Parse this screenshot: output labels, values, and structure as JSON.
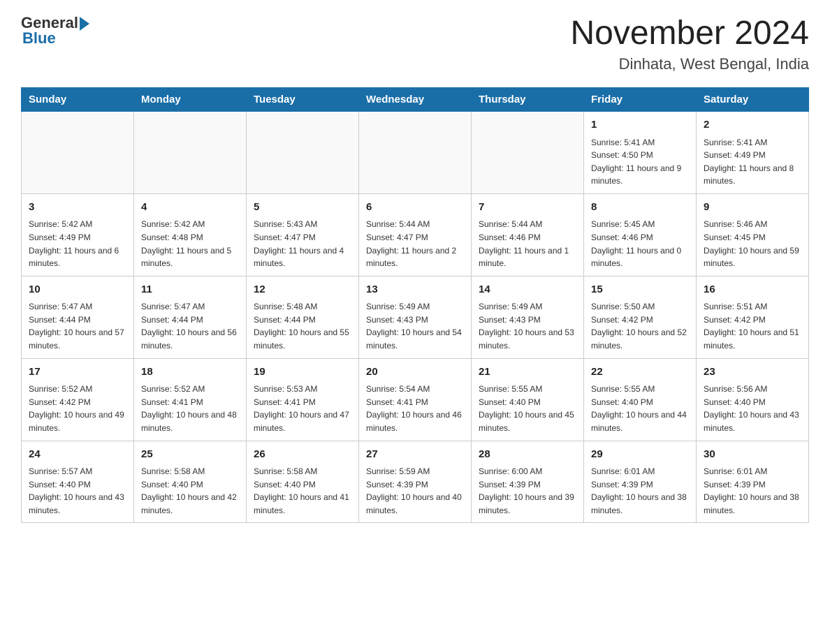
{
  "header": {
    "logo_general": "General",
    "logo_blue": "Blue",
    "main_title": "November 2024",
    "subtitle": "Dinhata, West Bengal, India"
  },
  "days_of_week": [
    "Sunday",
    "Monday",
    "Tuesday",
    "Wednesday",
    "Thursday",
    "Friday",
    "Saturday"
  ],
  "weeks": [
    [
      {
        "day": "",
        "info": ""
      },
      {
        "day": "",
        "info": ""
      },
      {
        "day": "",
        "info": ""
      },
      {
        "day": "",
        "info": ""
      },
      {
        "day": "",
        "info": ""
      },
      {
        "day": "1",
        "info": "Sunrise: 5:41 AM\nSunset: 4:50 PM\nDaylight: 11 hours and 9 minutes."
      },
      {
        "day": "2",
        "info": "Sunrise: 5:41 AM\nSunset: 4:49 PM\nDaylight: 11 hours and 8 minutes."
      }
    ],
    [
      {
        "day": "3",
        "info": "Sunrise: 5:42 AM\nSunset: 4:49 PM\nDaylight: 11 hours and 6 minutes."
      },
      {
        "day": "4",
        "info": "Sunrise: 5:42 AM\nSunset: 4:48 PM\nDaylight: 11 hours and 5 minutes."
      },
      {
        "day": "5",
        "info": "Sunrise: 5:43 AM\nSunset: 4:47 PM\nDaylight: 11 hours and 4 minutes."
      },
      {
        "day": "6",
        "info": "Sunrise: 5:44 AM\nSunset: 4:47 PM\nDaylight: 11 hours and 2 minutes."
      },
      {
        "day": "7",
        "info": "Sunrise: 5:44 AM\nSunset: 4:46 PM\nDaylight: 11 hours and 1 minute."
      },
      {
        "day": "8",
        "info": "Sunrise: 5:45 AM\nSunset: 4:46 PM\nDaylight: 11 hours and 0 minutes."
      },
      {
        "day": "9",
        "info": "Sunrise: 5:46 AM\nSunset: 4:45 PM\nDaylight: 10 hours and 59 minutes."
      }
    ],
    [
      {
        "day": "10",
        "info": "Sunrise: 5:47 AM\nSunset: 4:44 PM\nDaylight: 10 hours and 57 minutes."
      },
      {
        "day": "11",
        "info": "Sunrise: 5:47 AM\nSunset: 4:44 PM\nDaylight: 10 hours and 56 minutes."
      },
      {
        "day": "12",
        "info": "Sunrise: 5:48 AM\nSunset: 4:44 PM\nDaylight: 10 hours and 55 minutes."
      },
      {
        "day": "13",
        "info": "Sunrise: 5:49 AM\nSunset: 4:43 PM\nDaylight: 10 hours and 54 minutes."
      },
      {
        "day": "14",
        "info": "Sunrise: 5:49 AM\nSunset: 4:43 PM\nDaylight: 10 hours and 53 minutes."
      },
      {
        "day": "15",
        "info": "Sunrise: 5:50 AM\nSunset: 4:42 PM\nDaylight: 10 hours and 52 minutes."
      },
      {
        "day": "16",
        "info": "Sunrise: 5:51 AM\nSunset: 4:42 PM\nDaylight: 10 hours and 51 minutes."
      }
    ],
    [
      {
        "day": "17",
        "info": "Sunrise: 5:52 AM\nSunset: 4:42 PM\nDaylight: 10 hours and 49 minutes."
      },
      {
        "day": "18",
        "info": "Sunrise: 5:52 AM\nSunset: 4:41 PM\nDaylight: 10 hours and 48 minutes."
      },
      {
        "day": "19",
        "info": "Sunrise: 5:53 AM\nSunset: 4:41 PM\nDaylight: 10 hours and 47 minutes."
      },
      {
        "day": "20",
        "info": "Sunrise: 5:54 AM\nSunset: 4:41 PM\nDaylight: 10 hours and 46 minutes."
      },
      {
        "day": "21",
        "info": "Sunrise: 5:55 AM\nSunset: 4:40 PM\nDaylight: 10 hours and 45 minutes."
      },
      {
        "day": "22",
        "info": "Sunrise: 5:55 AM\nSunset: 4:40 PM\nDaylight: 10 hours and 44 minutes."
      },
      {
        "day": "23",
        "info": "Sunrise: 5:56 AM\nSunset: 4:40 PM\nDaylight: 10 hours and 43 minutes."
      }
    ],
    [
      {
        "day": "24",
        "info": "Sunrise: 5:57 AM\nSunset: 4:40 PM\nDaylight: 10 hours and 43 minutes."
      },
      {
        "day": "25",
        "info": "Sunrise: 5:58 AM\nSunset: 4:40 PM\nDaylight: 10 hours and 42 minutes."
      },
      {
        "day": "26",
        "info": "Sunrise: 5:58 AM\nSunset: 4:40 PM\nDaylight: 10 hours and 41 minutes."
      },
      {
        "day": "27",
        "info": "Sunrise: 5:59 AM\nSunset: 4:39 PM\nDaylight: 10 hours and 40 minutes."
      },
      {
        "day": "28",
        "info": "Sunrise: 6:00 AM\nSunset: 4:39 PM\nDaylight: 10 hours and 39 minutes."
      },
      {
        "day": "29",
        "info": "Sunrise: 6:01 AM\nSunset: 4:39 PM\nDaylight: 10 hours and 38 minutes."
      },
      {
        "day": "30",
        "info": "Sunrise: 6:01 AM\nSunset: 4:39 PM\nDaylight: 10 hours and 38 minutes."
      }
    ]
  ]
}
